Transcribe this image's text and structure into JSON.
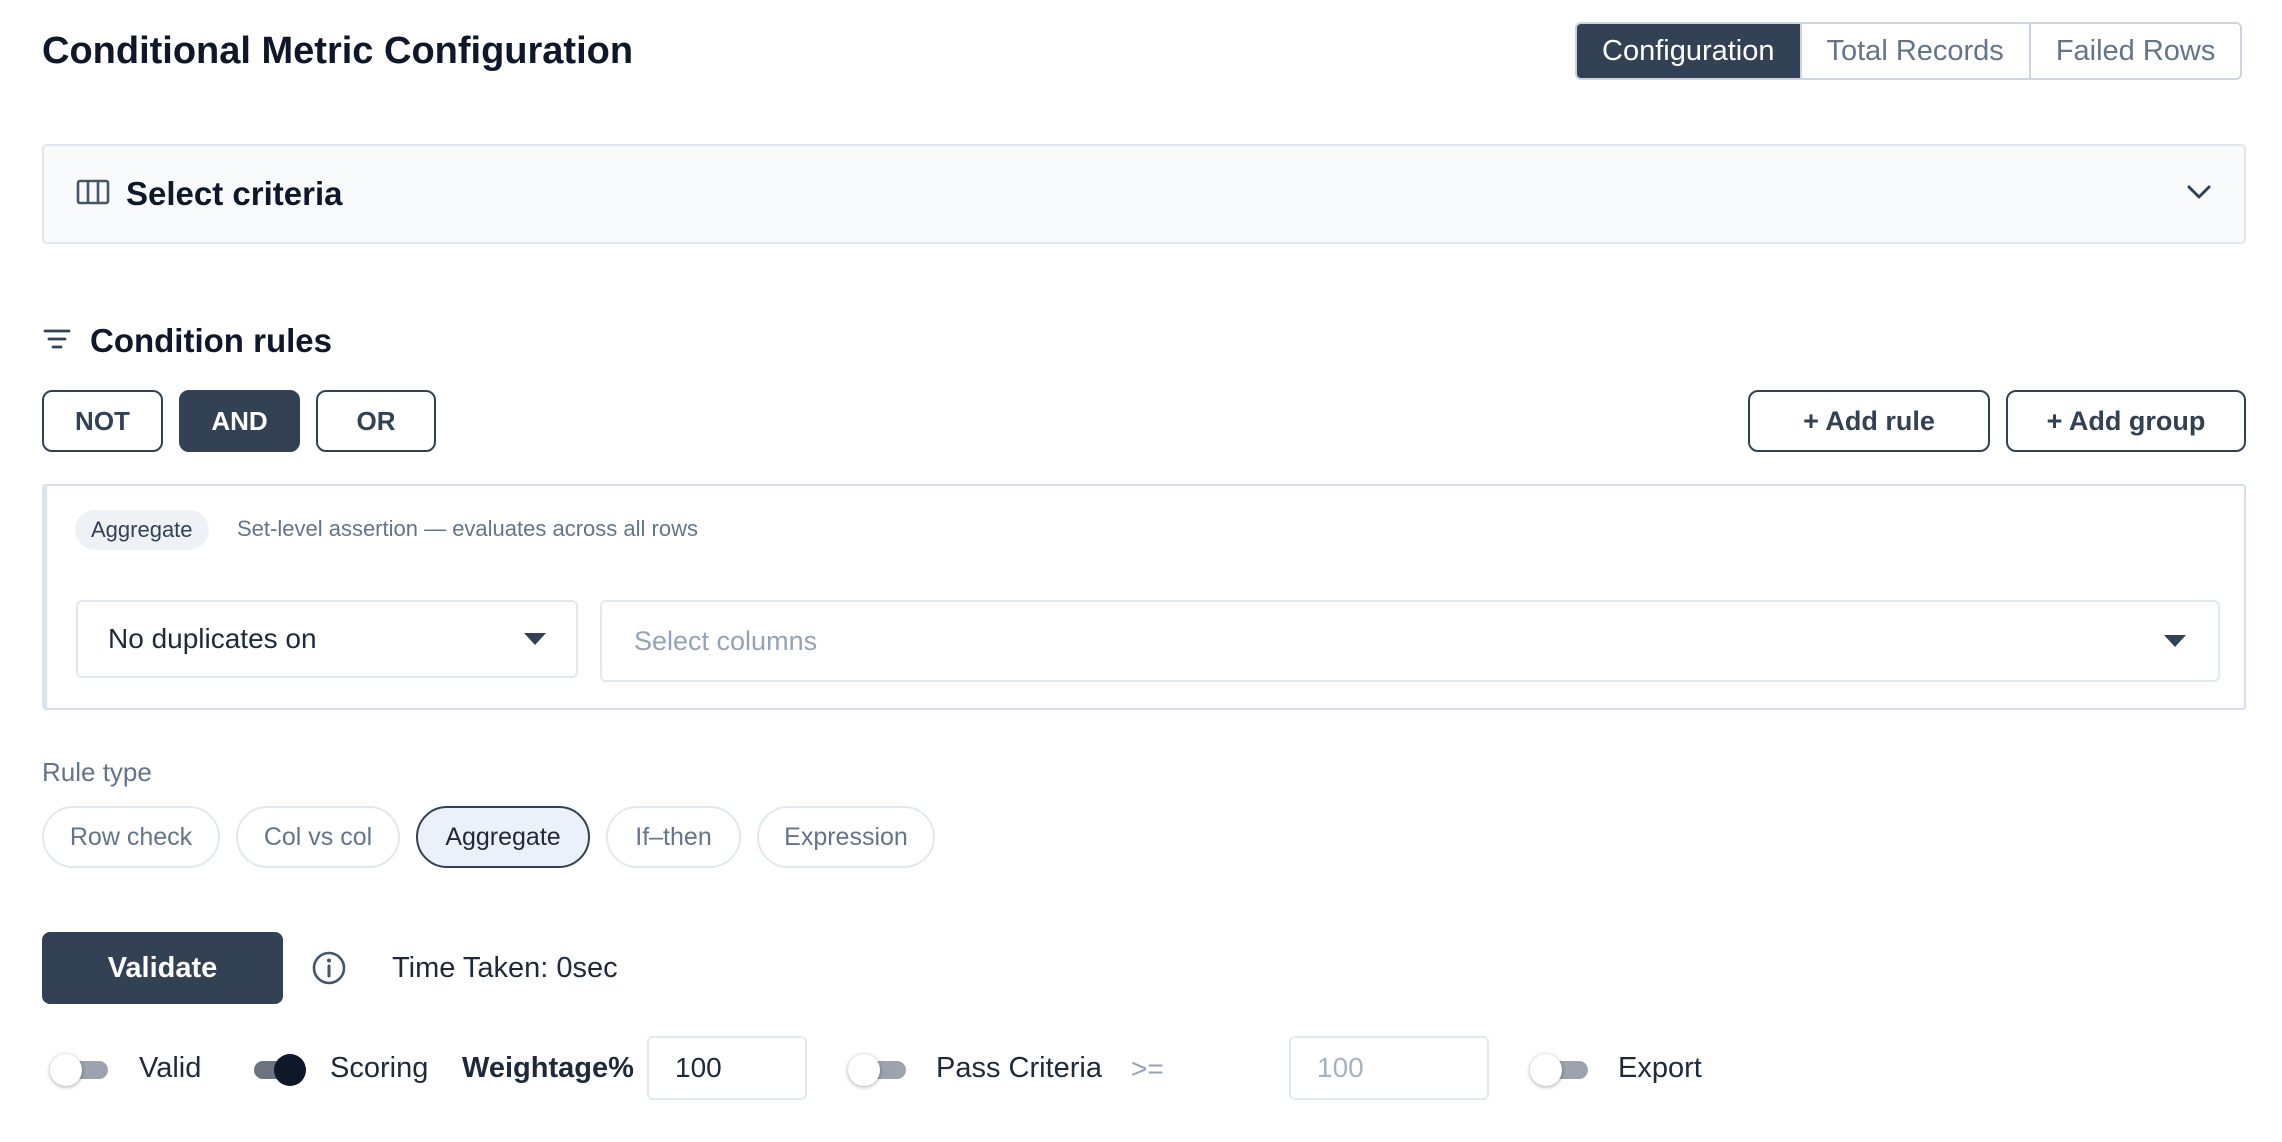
{
  "header": {
    "title": "Conditional Metric Configuration",
    "tabs": [
      {
        "label": "Configuration",
        "active": true
      },
      {
        "label": "Total Records",
        "active": false
      },
      {
        "label": "Failed Rows",
        "active": false
      }
    ]
  },
  "criteria": {
    "title": "Select criteria",
    "icon": "columns-icon",
    "expand_icon": "chevron-down-icon"
  },
  "conditions": {
    "title": "Condition rules",
    "icon": "filter-icon",
    "logic": [
      {
        "label": "NOT",
        "active": false
      },
      {
        "label": "AND",
        "active": true
      },
      {
        "label": "OR",
        "active": false
      }
    ],
    "add_rule_label": "+ Add rule",
    "add_group_label": "+ Add group",
    "rule": {
      "badge": "Aggregate",
      "description": "Set-level assertion — evaluates across all rows",
      "assertion_value": "No duplicates on",
      "columns_placeholder": "Select columns"
    }
  },
  "rule_type": {
    "label": "Rule type",
    "options": [
      {
        "label": "Row check",
        "active": false
      },
      {
        "label": "Col vs col",
        "active": false
      },
      {
        "label": "Aggregate",
        "active": true
      },
      {
        "label": "If–then",
        "active": false
      },
      {
        "label": "Expression",
        "active": false
      }
    ]
  },
  "actions": {
    "validate_label": "Validate",
    "info_icon": "info-icon",
    "time_taken": "Time Taken: 0sec"
  },
  "settings": {
    "valid": {
      "label": "Valid",
      "on": false
    },
    "scoring": {
      "label": "Scoring",
      "on": true
    },
    "weightage_label": "Weightage%",
    "weightage_value": "100",
    "pass_criteria": {
      "label": "Pass Criteria",
      "on": false
    },
    "operator": ">=",
    "pass_placeholder": "100",
    "export": {
      "label": "Export",
      "on": false
    }
  },
  "colors": {
    "primary": "#334155",
    "border": "#e2e8f0",
    "muted_text": "#64748b",
    "chip_active_bg": "#eaf1fb"
  }
}
